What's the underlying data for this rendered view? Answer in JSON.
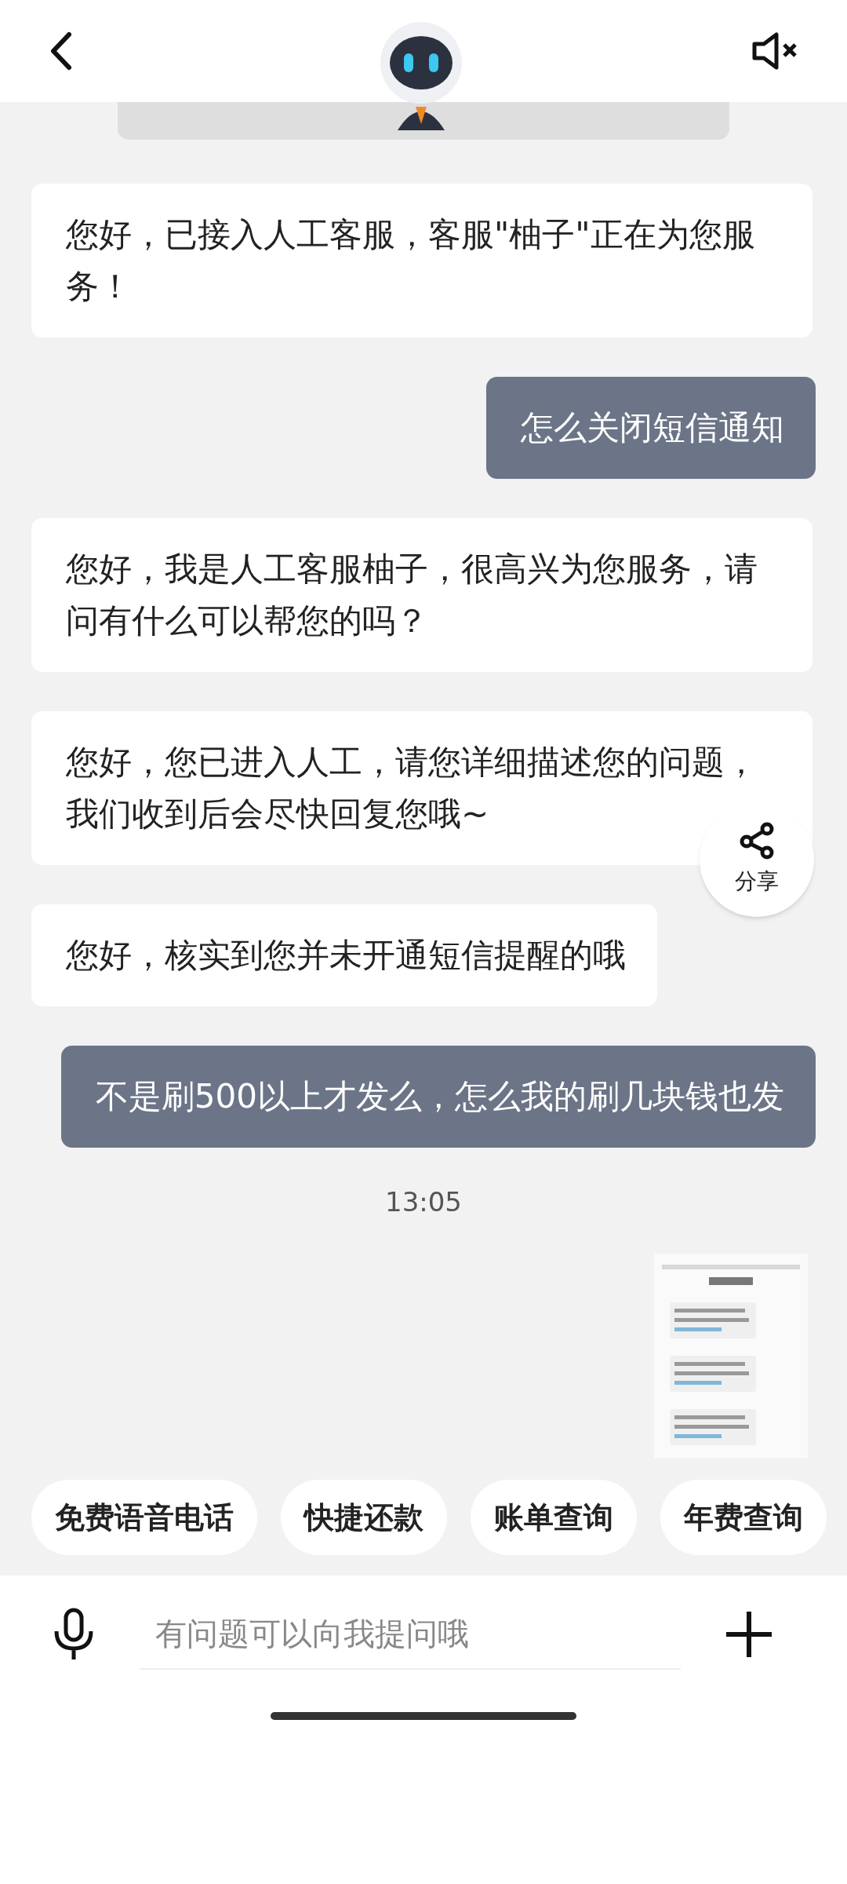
{
  "messages": [
    {
      "outgoing": false,
      "text": "您好，已接入人工客服，客服\"柚子\"正在为您服务！"
    },
    {
      "outgoing": true,
      "text": "怎么关闭短信通知"
    },
    {
      "outgoing": false,
      "text": "您好，我是人工客服柚子，很高兴为您服务，请问有什么可以帮您的吗？"
    },
    {
      "outgoing": false,
      "text": "您好，您已进入人工，请您详细描述您的问题，我们收到后会尽快回复您哦~"
    },
    {
      "outgoing": false,
      "text": "您好，核实到您并未开通短信提醒的哦"
    },
    {
      "outgoing": true,
      "text": "不是刷500以上才发么，怎么我的刷几块钱也发"
    }
  ],
  "share": {
    "label": "分享"
  },
  "timestamp": "13:05",
  "quick_actions": [
    "免费语音电话",
    "快捷还款",
    "账单查询",
    "年费查询"
  ],
  "input": {
    "placeholder": "有问题可以向我提问哦"
  }
}
